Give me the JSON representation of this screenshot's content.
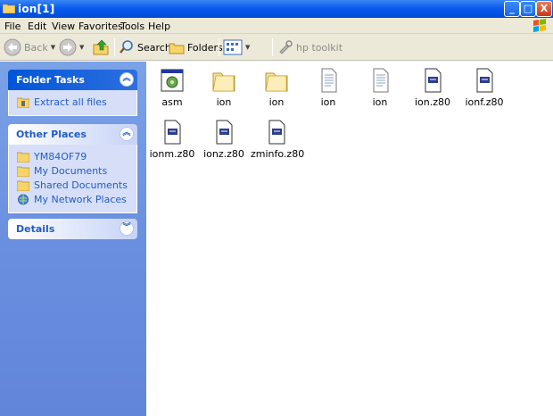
{
  "window": {
    "title": "ion[1]",
    "controls": {
      "minimize": "_",
      "maximize": "□",
      "close": "X"
    }
  },
  "menu": [
    "File",
    "Edit",
    "View",
    "Favorites",
    "Tools",
    "Help"
  ],
  "toolbar": {
    "back": "Back",
    "search": "Search",
    "folders": "Folders",
    "hp_toolkit": "hp toolkit"
  },
  "sidebar": {
    "folder_tasks": {
      "title": "Folder Tasks",
      "items": [
        {
          "label": "Extract all files",
          "icon": "extract-icon"
        }
      ]
    },
    "other_places": {
      "title": "Other Places",
      "items": [
        {
          "label": "YM84OF79",
          "icon": "folder-icon"
        },
        {
          "label": "My Documents",
          "icon": "folder-icon"
        },
        {
          "label": "Shared Documents",
          "icon": "folder-icon"
        },
        {
          "label": "My Network Places",
          "icon": "network-icon"
        }
      ]
    },
    "details": {
      "title": "Details"
    }
  },
  "files": [
    {
      "name": "asm",
      "icon": "program-icon"
    },
    {
      "name": "ion",
      "icon": "folder-icon"
    },
    {
      "name": "ion",
      "icon": "folder-icon"
    },
    {
      "name": "ion",
      "icon": "text-file-icon"
    },
    {
      "name": "ion",
      "icon": "text-file-icon"
    },
    {
      "name": "ion.z80",
      "icon": "z80-file-icon"
    },
    {
      "name": "ionf.z80",
      "icon": "z80-file-icon"
    },
    {
      "name": "ionm.z80",
      "icon": "z80-file-icon"
    },
    {
      "name": "ionz.z80",
      "icon": "z80-file-icon"
    },
    {
      "name": "zminfo.z80",
      "icon": "z80-file-icon"
    }
  ],
  "colors": {
    "titlebar": "#0a5cf0",
    "taskpane": "#6e93e2",
    "link": "#215dc6"
  }
}
